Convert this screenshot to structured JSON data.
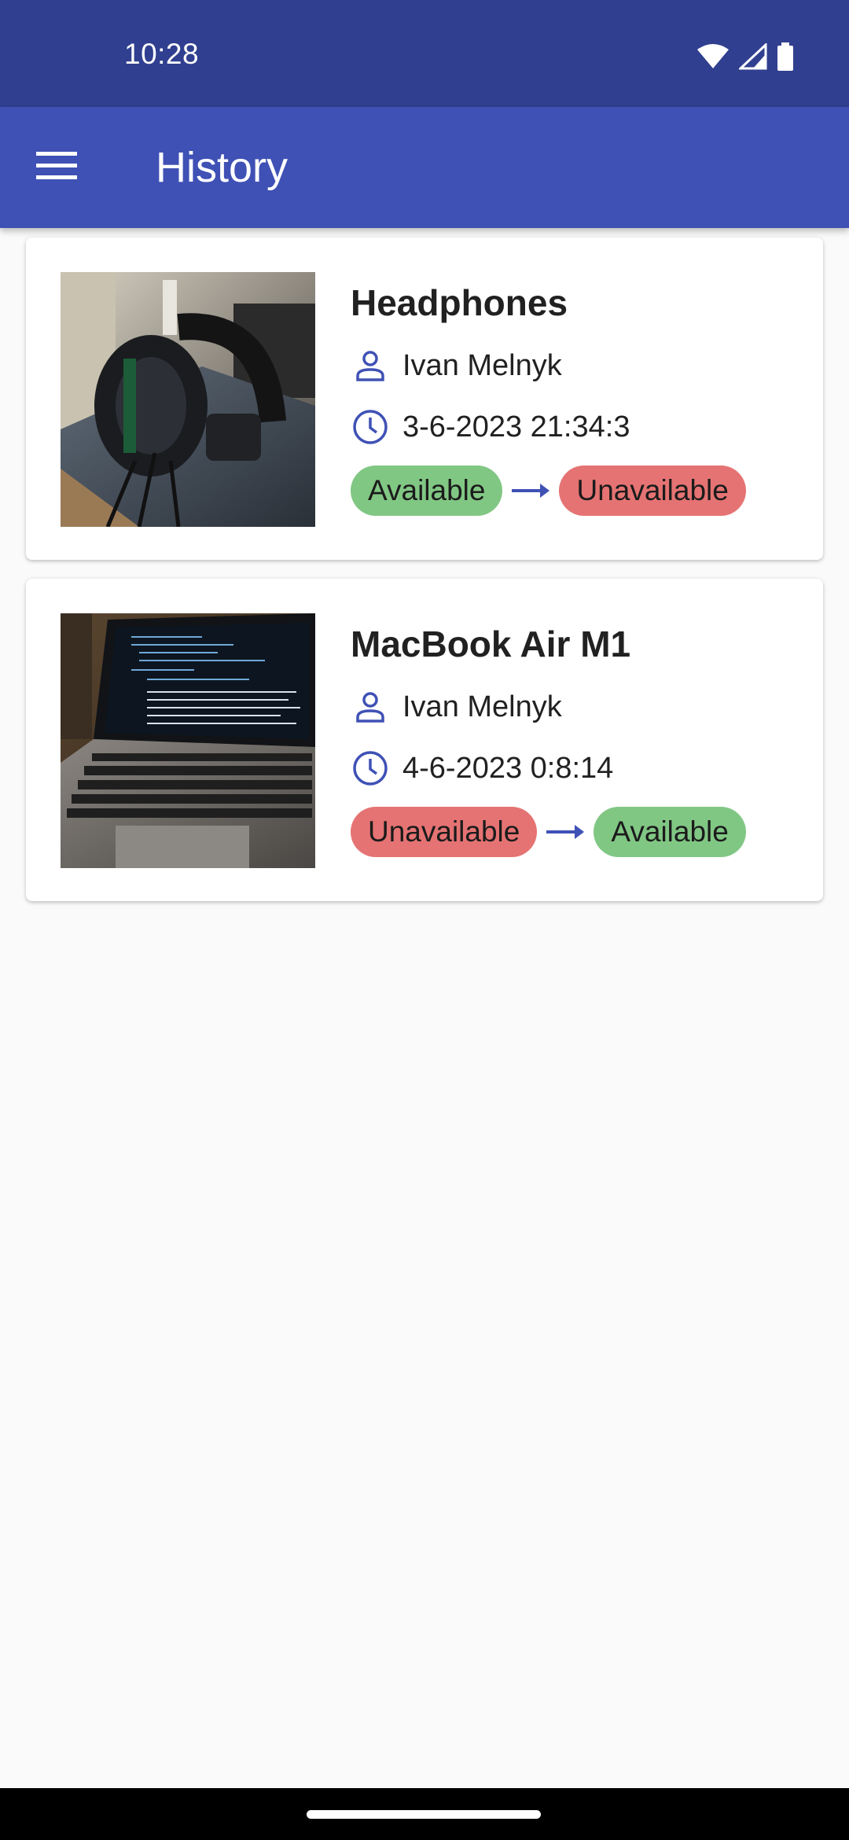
{
  "status_bar": {
    "time": "10:28",
    "icons": [
      "wifi-icon",
      "cell-signal-icon",
      "battery-icon"
    ]
  },
  "app_bar": {
    "title": "History",
    "menu_icon": "menu-icon"
  },
  "colors": {
    "status_bar": "#303f8f",
    "app_bar": "#3f51b5",
    "available": "#81c784",
    "unavailable": "#e57373",
    "icon_accent": "#3f51b5"
  },
  "history": [
    {
      "name": "Headphones",
      "user": "Ivan Melnyk",
      "timestamp": "3-6-2023 21:34:3",
      "from_status": "Available",
      "to_status": "Unavailable",
      "photo": "headphones-photo"
    },
    {
      "name": "MacBook Air M1",
      "user": "Ivan Melnyk",
      "timestamp": "4-6-2023 0:8:14",
      "from_status": "Unavailable",
      "to_status": "Available",
      "photo": "laptop-photo"
    }
  ]
}
